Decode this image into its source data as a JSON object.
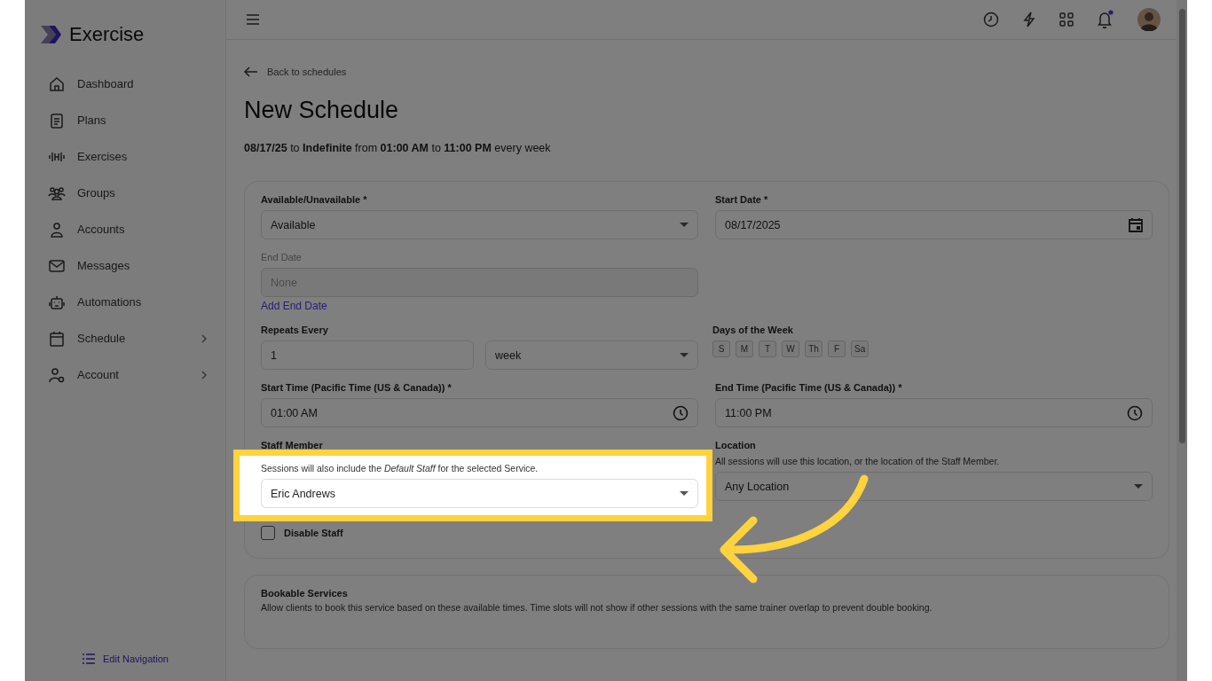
{
  "app": {
    "name": "Exercise"
  },
  "sidebar": {
    "items": [
      {
        "label": "Dashboard",
        "expandable": false
      },
      {
        "label": "Plans",
        "expandable": false
      },
      {
        "label": "Exercises",
        "expandable": false
      },
      {
        "label": "Groups",
        "expandable": false
      },
      {
        "label": "Accounts",
        "expandable": false
      },
      {
        "label": "Messages",
        "expandable": false
      },
      {
        "label": "Automations",
        "expandable": false
      },
      {
        "label": "Schedule",
        "expandable": true
      },
      {
        "label": "Account",
        "expandable": true
      }
    ],
    "edit_navigation": "Edit Navigation"
  },
  "back_link": "Back to schedules",
  "title": "New Schedule",
  "summary": "**08/17/25** to **Indefinite** from **01:00 AM** to **11:00 PM** every week",
  "form": {
    "availability": {
      "label": "Available/Unavailable *",
      "value": "Available"
    },
    "start_date": {
      "label": "Start Date *",
      "value": "08/17/2025"
    },
    "end_date": {
      "label": "End Date",
      "placeholder": "None",
      "disabled": true
    },
    "add_end_date": "Add End Date",
    "repeats": {
      "label": "Repeats Every",
      "count": "1",
      "unit": "week"
    },
    "days": {
      "label": "Days of the Week",
      "items": [
        {
          "label": "S",
          "selected": false
        },
        {
          "label": "M",
          "selected": false
        },
        {
          "label": "T",
          "selected": false
        },
        {
          "label": "W",
          "selected": false
        },
        {
          "label": "Th",
          "selected": false
        },
        {
          "label": "F",
          "selected": false
        },
        {
          "label": "Sa",
          "selected": false
        }
      ]
    },
    "start_time": {
      "label": "Start Time (Pacific Time (US & Canada)) *",
      "value": "01:00 AM"
    },
    "end_time": {
      "label": "End Time (Pacific Time (US & Canada)) *",
      "value": "11:00 PM"
    },
    "staff": {
      "label": "Staff Member",
      "hint": "Sessions will also include the *Default Staff* for the selected Service.",
      "value": "Eric Andrews",
      "highlighted": true
    },
    "disable_staff": {
      "label": "Disable Staff",
      "checked": false
    },
    "location": {
      "label": "Location",
      "hint": "All sessions will use this location, or the location of the Staff Member.",
      "value": "Any Location"
    }
  },
  "bookable_services": {
    "title": "Bookable Services",
    "description": "Allow clients to book this service based on these available times. Time slots will not show if other sessions with the same trainer overlap to prevent double booking."
  }
}
